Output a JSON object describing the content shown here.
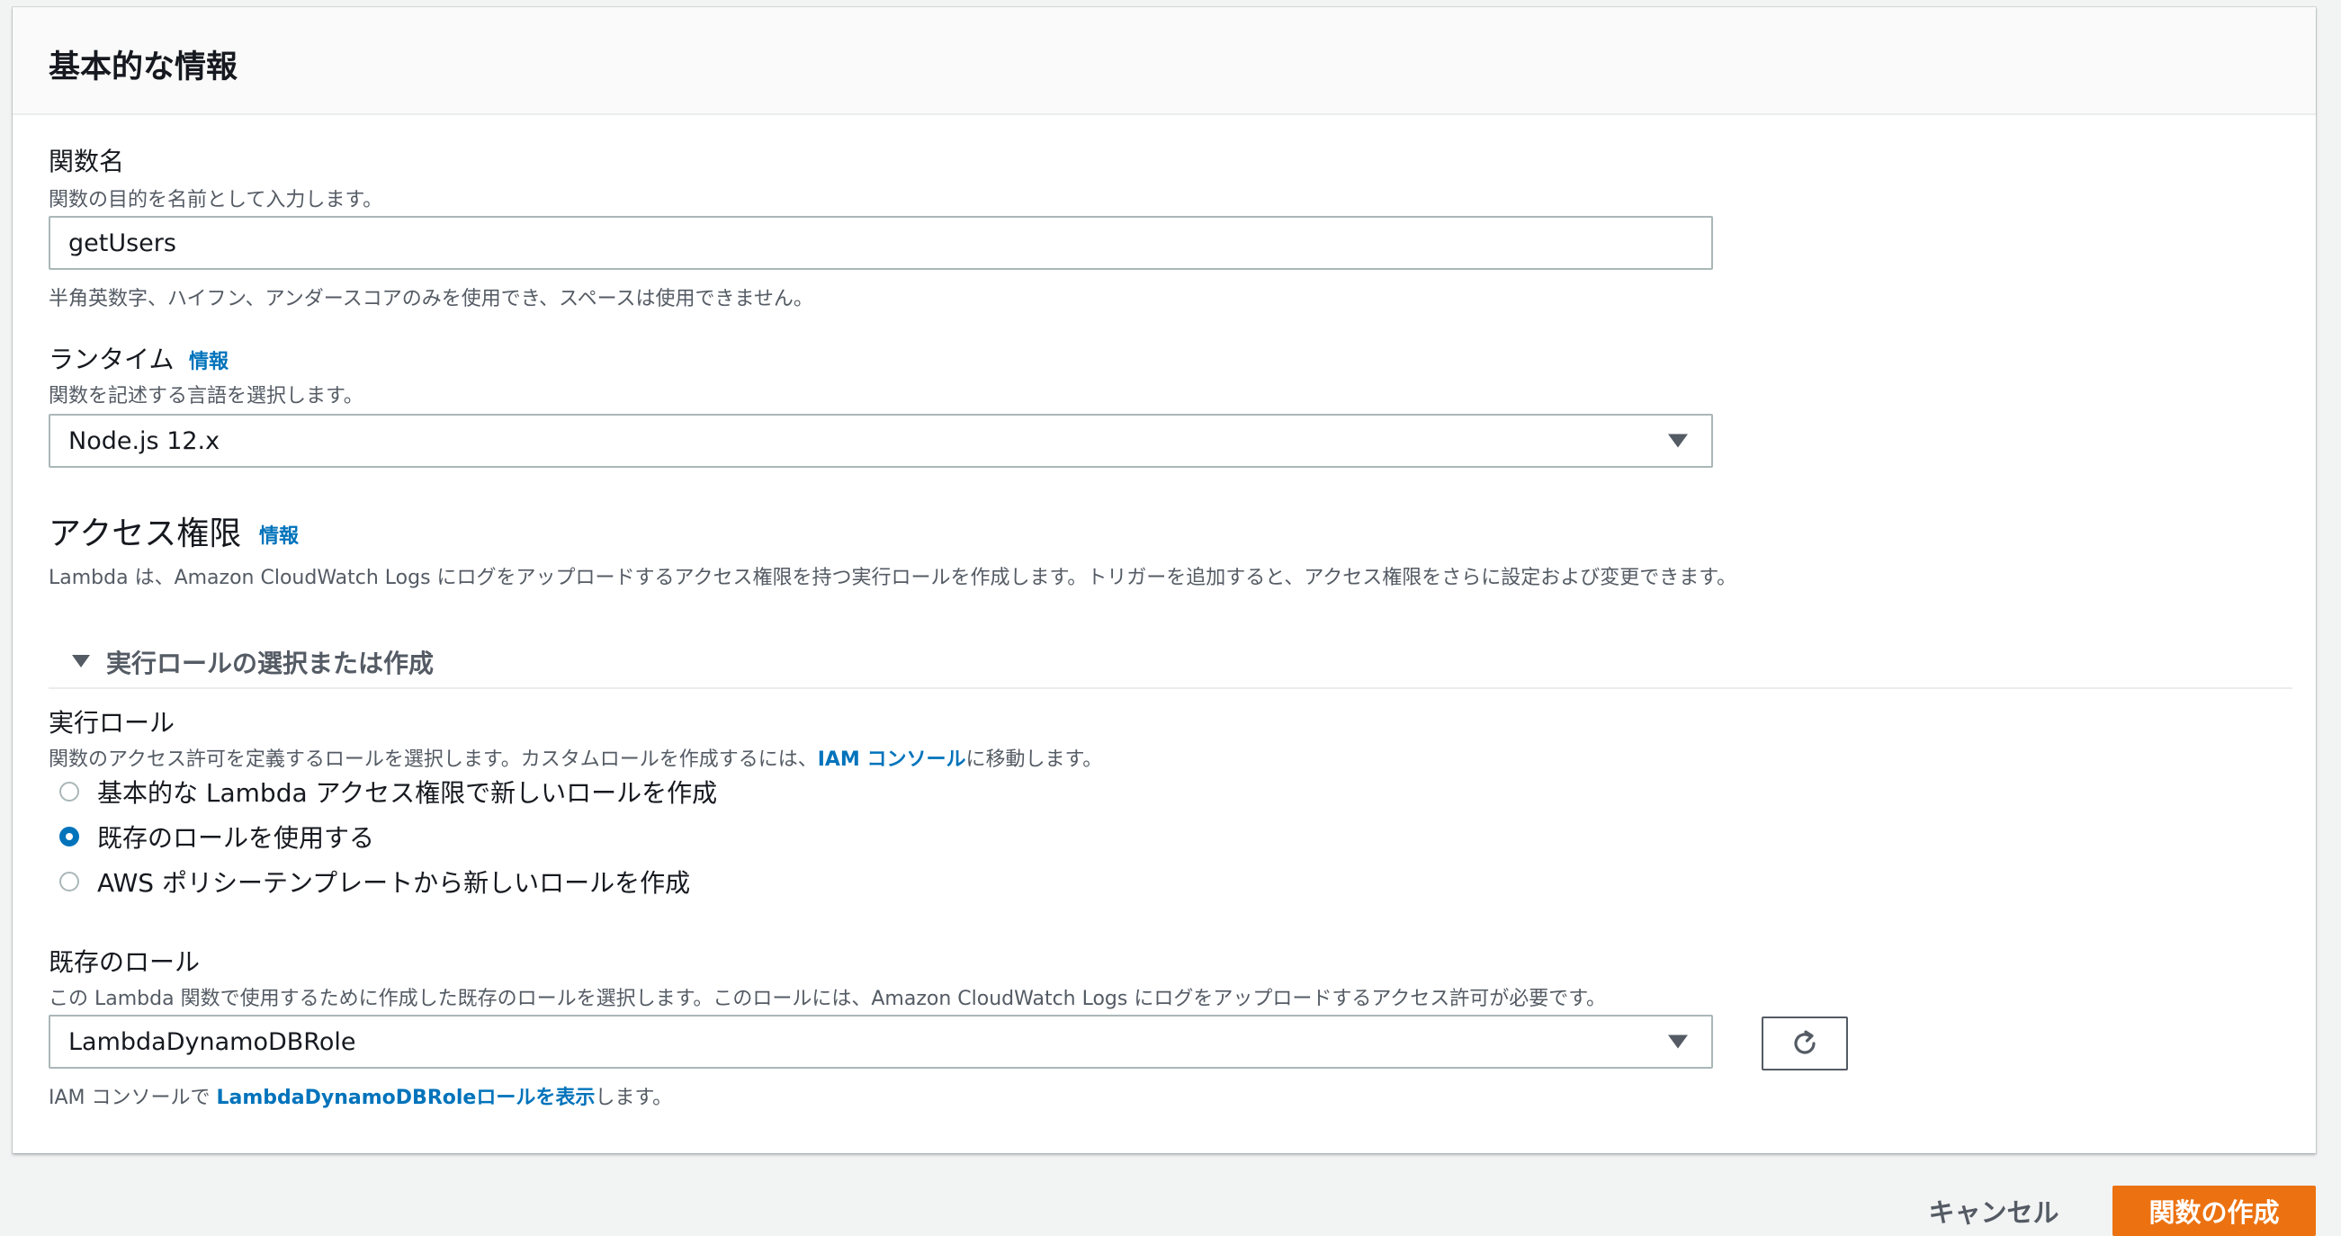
{
  "panel": {
    "title": "基本的な情報"
  },
  "function_name": {
    "label": "関数名",
    "description": "関数の目的を名前として入力します。",
    "value": "getUsers",
    "constraint": "半角英数字、ハイフン、アンダースコアのみを使用でき、スペースは使用できません。"
  },
  "runtime": {
    "label": "ランタイム",
    "info_link": "情報",
    "description": "関数を記述する言語を選択します。",
    "selected": "Node.js 12.x"
  },
  "access": {
    "heading": "アクセス権限",
    "info_link": "情報",
    "description": "Lambda は、Amazon CloudWatch Logs にログをアップロードするアクセス権限を持つ実行ロールを作成します。トリガーを追加すると、アクセス権限をさらに設定および変更できます。"
  },
  "execution_role_section": {
    "expander_label": "実行ロールの選択または作成",
    "label": "実行ロール",
    "description_prefix": "関数のアクセス許可を定義するロールを選択します。カスタムロールを作成するには、",
    "description_link": "IAM コンソール",
    "description_suffix": "に移動します。",
    "options": [
      {
        "label": "基本的な Lambda アクセス権限で新しいロールを作成",
        "selected": false
      },
      {
        "label": "既存のロールを使用する",
        "selected": true
      },
      {
        "label": "AWS ポリシーテンプレートから新しいロールを作成",
        "selected": false
      }
    ]
  },
  "existing_role": {
    "label": "既存のロール",
    "description": "この Lambda 関数で使用するために作成した既存のロールを選択します。このロールには、Amazon CloudWatch Logs にログをアップロードするアクセス許可が必要です。",
    "selected": "LambdaDynamoDBRole",
    "refresh_icon": "refresh-icon",
    "footer_prefix": "IAM コンソールで ",
    "footer_link": "LambdaDynamoDBRoleロールを表示",
    "footer_suffix": "します。"
  },
  "actions": {
    "cancel": "キャンセル",
    "create": "関数の作成"
  },
  "colors": {
    "accent_link": "#0073bb",
    "primary_button": "#ec7211",
    "background": "#f2f3f3"
  }
}
